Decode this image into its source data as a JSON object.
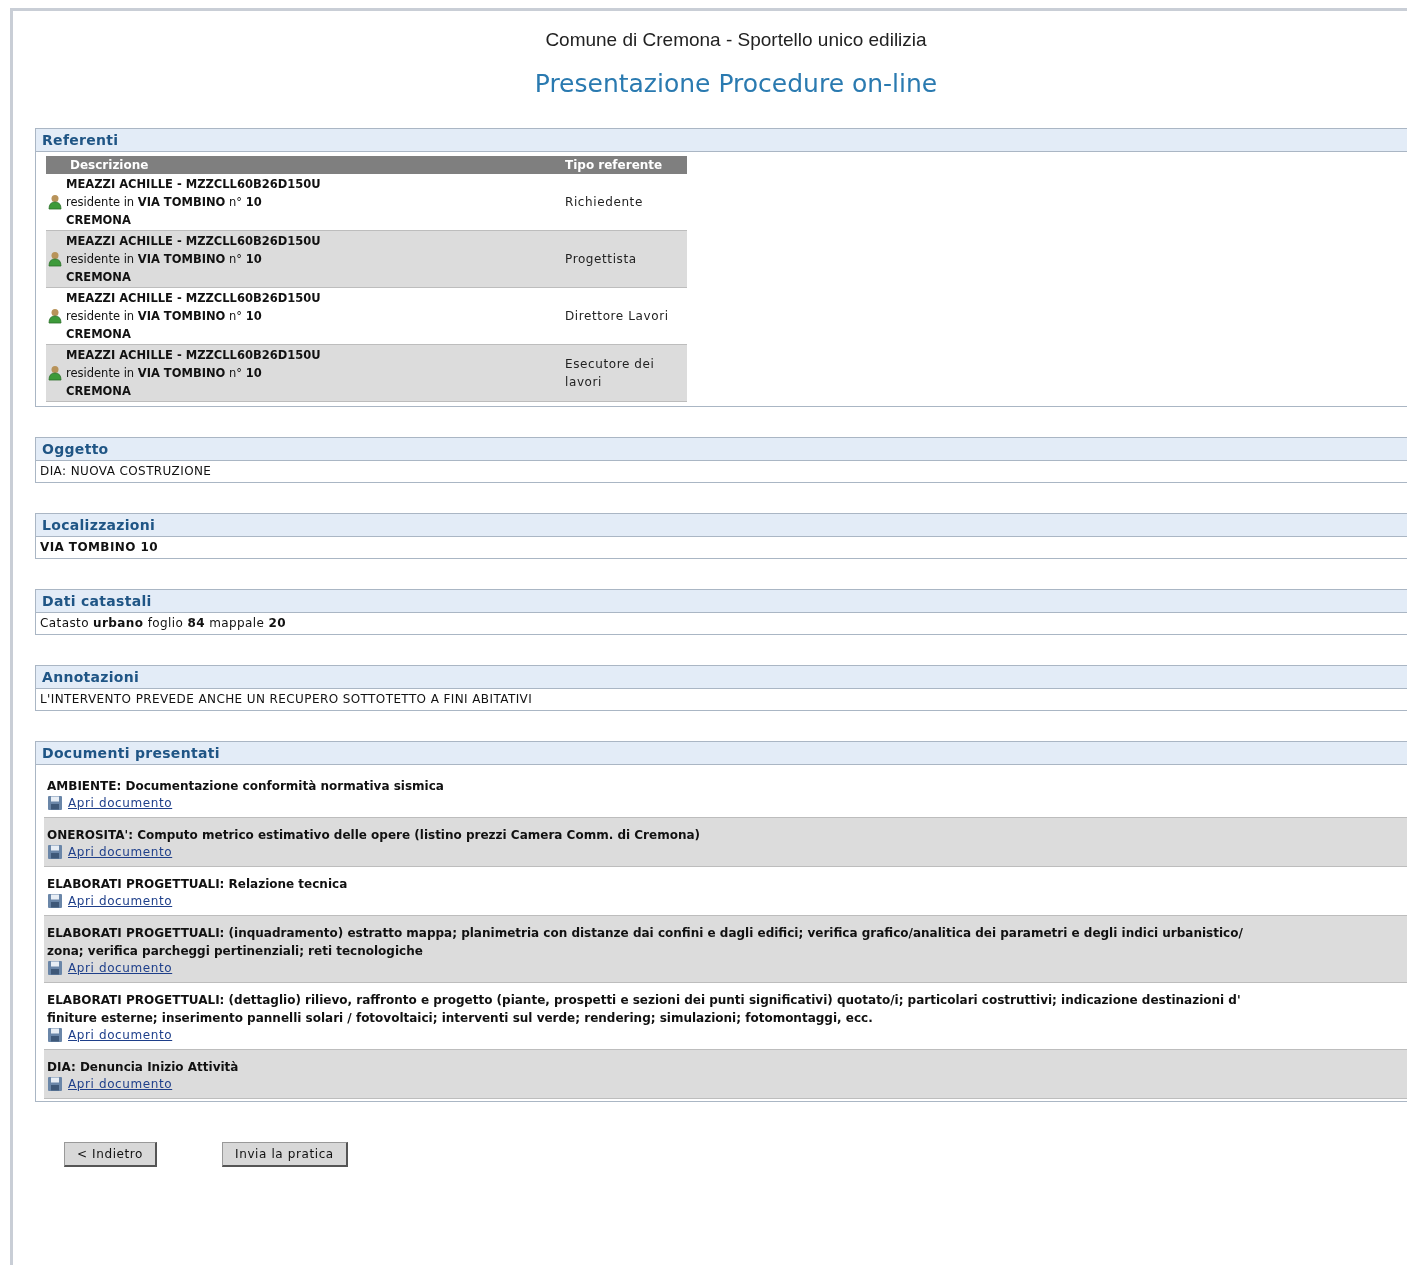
{
  "header": {
    "subtitle": "Comune di Cremona - Sportello unico edilizia",
    "title": "Presentazione Procedure on-line"
  },
  "sections": [
    {
      "kind": "table",
      "title": "Referenti",
      "columns": [
        "Descrizione",
        "Tipo referente"
      ],
      "rows": [
        {
          "lines": [
            "**MEAZZI ACHILLE - MZZCLL60B26D150U**",
            "residente in **VIA TOMBINO** n° **10**",
            "**CREMONA**"
          ],
          "type": "Richiedente"
        },
        {
          "lines": [
            "**MEAZZI ACHILLE - MZZCLL60B26D150U**",
            "residente in **VIA TOMBINO** n° **10**",
            "**CREMONA**"
          ],
          "type": "Progettista"
        },
        {
          "lines": [
            "**MEAZZI ACHILLE - MZZCLL60B26D150U**",
            "residente in **VIA TOMBINO** n° **10**",
            "**CREMONA**"
          ],
          "type": "Direttore Lavori"
        },
        {
          "lines": [
            "**MEAZZI ACHILLE - MZZCLL60B26D150U**",
            "residente in **VIA TOMBINO** n° **10**",
            "**CREMONA**"
          ],
          "type": "Esecutore dei lavori"
        }
      ]
    },
    {
      "kind": "text",
      "title": "Oggetto",
      "text": "DIA: NUOVA COSTRUZIONE"
    },
    {
      "kind": "strong_text",
      "title": "Localizzazioni",
      "text": "VIA TOMBINO 10"
    },
    {
      "kind": "text",
      "title": "Dati catastali",
      "text": "Catasto **urbano** foglio **84** mappale **20**"
    },
    {
      "kind": "text",
      "title": "Annotazioni",
      "text": "L'INTERVENTO PREVEDE ANCHE UN RECUPERO SOTTOTETTO A FINI ABITATIVI"
    },
    {
      "kind": "documents",
      "title": "Documenti presentati",
      "documents": [
        {
          "lines": [
            "AMBIENTE: Documentazione conformità normativa sismica"
          ],
          "link": "Apri documento"
        },
        {
          "lines": [
            "ONEROSITA': Computo metrico estimativo delle opere (listino prezzi Camera Comm. di Cremona)"
          ],
          "link": "Apri documento"
        },
        {
          "lines": [
            "ELABORATI PROGETTUALI: Relazione tecnica"
          ],
          "link": "Apri documento"
        },
        {
          "lines": [
            "ELABORATI PROGETTUALI: (inquadramento) estratto mappa; planimetria con distanze dai confini e dagli edifici; verifica grafico/analitica dei parametri e degli indici urbanistico/",
            "zona; verifica parcheggi pertinenziali; reti tecnologiche"
          ],
          "link": "Apri documento"
        },
        {
          "lines": [
            "ELABORATI PROGETTUALI: (dettaglio) rilievo, raffronto e progetto (piante, prospetti e sezioni dei punti significativi) quotato/i; particolari costruttivi; indicazione destinazioni d'",
            "finiture esterne; inserimento pannelli solari / fotovoltaici; interventi sul verde; rendering; simulazioni; fotomontaggi, ecc."
          ],
          "link": "Apri documento"
        },
        {
          "lines": [
            "DIA: Denuncia Inizio Attività"
          ],
          "link": "Apri documento"
        }
      ]
    }
  ],
  "buttons": [
    "< Indietro",
    "Invia la pratica"
  ]
}
